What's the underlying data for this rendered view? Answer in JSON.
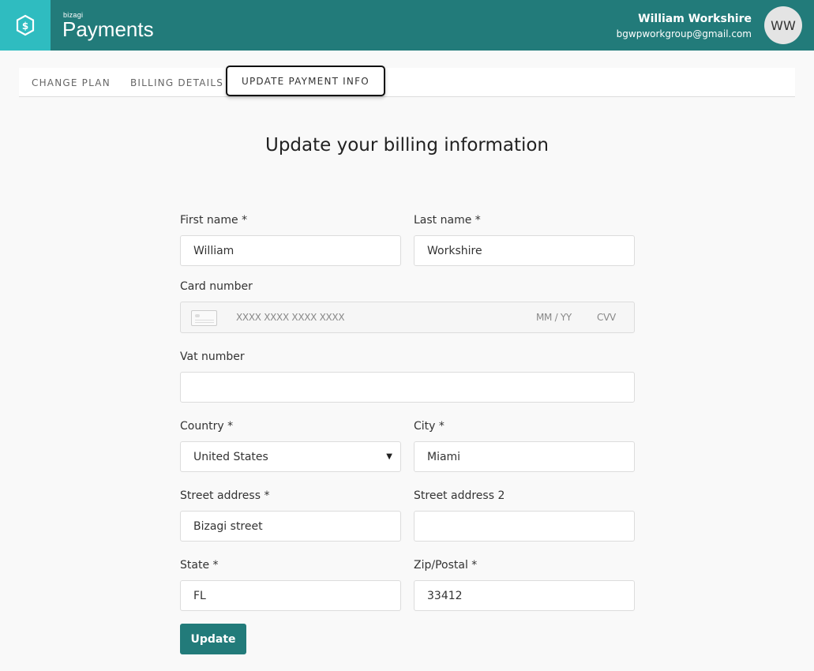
{
  "header": {
    "brand_small": "bizagi",
    "brand_title": "Payments",
    "logo_icon": "dollar-hexagon-icon",
    "user_name": "William Workshire",
    "user_email": "bgwpworkgroup@gmail.com",
    "avatar_initials": "WW"
  },
  "tabs": [
    {
      "label": "CHANGE PLAN",
      "active": false
    },
    {
      "label": "BILLING DETAILS",
      "active": false
    },
    {
      "label": "UPDATE PAYMENT INFO",
      "active": true
    }
  ],
  "page_title": "Update your billing information",
  "form": {
    "first_name": {
      "label": "First name *",
      "value": "William"
    },
    "last_name": {
      "label": "Last name *",
      "value": "Workshire"
    },
    "card": {
      "label": "Card number",
      "number_placeholder": "XXXX XXXX XXXX XXXX",
      "expiry_placeholder": "MM / YY",
      "cvv_placeholder": "CVV"
    },
    "vat": {
      "label": "Vat number",
      "value": ""
    },
    "country": {
      "label": "Country *",
      "value": "United States"
    },
    "city": {
      "label": "City *",
      "value": "Miami"
    },
    "street1": {
      "label": "Street address *",
      "value": "Bizagi street"
    },
    "street2": {
      "label": "Street address 2",
      "value": ""
    },
    "state": {
      "label": "State *",
      "value": "FL"
    },
    "zip": {
      "label": "Zip/Postal *",
      "value": "33412"
    },
    "submit_label": "Update"
  }
}
